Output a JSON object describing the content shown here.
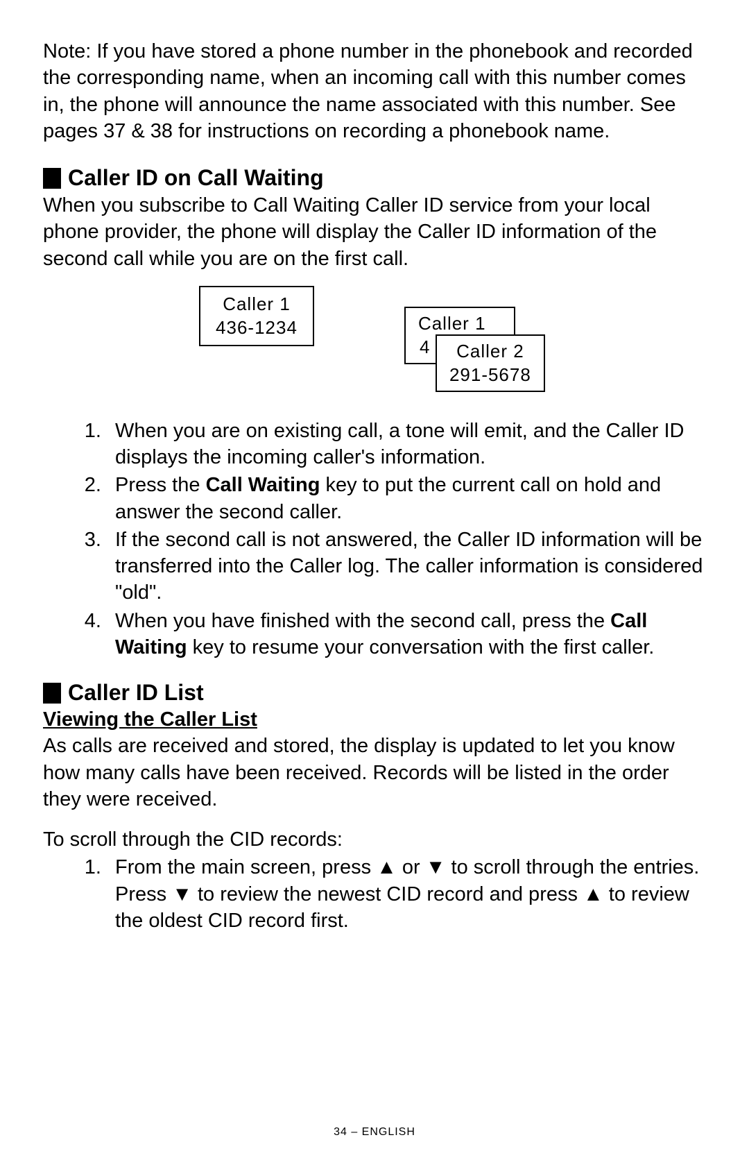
{
  "note": "Note: If you have stored a phone number in the phonebook and recorded the corresponding name, when an incoming call with this number comes in, the phone will announce the name associated with this number.  See pages 37 & 38 for instructions on recording a phonebook name.",
  "section1": {
    "heading": "Caller ID on Call Waiting",
    "body": "When you subscribe to Call Waiting Caller ID service from your local phone provider, the phone will display the Caller ID information of the second call while you are on the first call.",
    "lcd1_line1": "Caller  1",
    "lcd1_line2": "436-1234",
    "lcd_back_line1": "Caller  1",
    "lcd_back_line2": "4",
    "lcd_front_line1": "Caller  2",
    "lcd_front_line2": "291-5678",
    "steps": {
      "s1": "When you are on existing call, a tone will emit, and the Caller ID displays the incoming caller's information.",
      "s2a": "Press the ",
      "s2b": "Call Waiting",
      "s2c": " key to put the current call on hold and answer the second caller.",
      "s3": "If the second call is not answered, the Caller ID information will be transferred into the Caller log. The caller information is considered \"old\".",
      "s4a": "When you have finished with the second call, press the ",
      "s4b": "Call Waiting",
      "s4c": " key to resume your conversation with the first caller."
    }
  },
  "section2": {
    "heading": "Caller ID List",
    "subhead": "Viewing the Caller List",
    "body": "As calls are received and stored, the display is updated to let you know how many calls have been received. Records will be listed in the order they were received.",
    "lead": "To scroll through the CID records:",
    "steps": {
      "s1a": "From the main screen, press ",
      "up": "▲",
      "s1b": "  or ",
      "down": "▼",
      "s1c": "  to scroll through the entries.  Press ",
      "s1d": "  to review the newest CID record and press ",
      "s1e": "  to review the oldest CID record first."
    }
  },
  "footer": "34 – ENGLISH"
}
